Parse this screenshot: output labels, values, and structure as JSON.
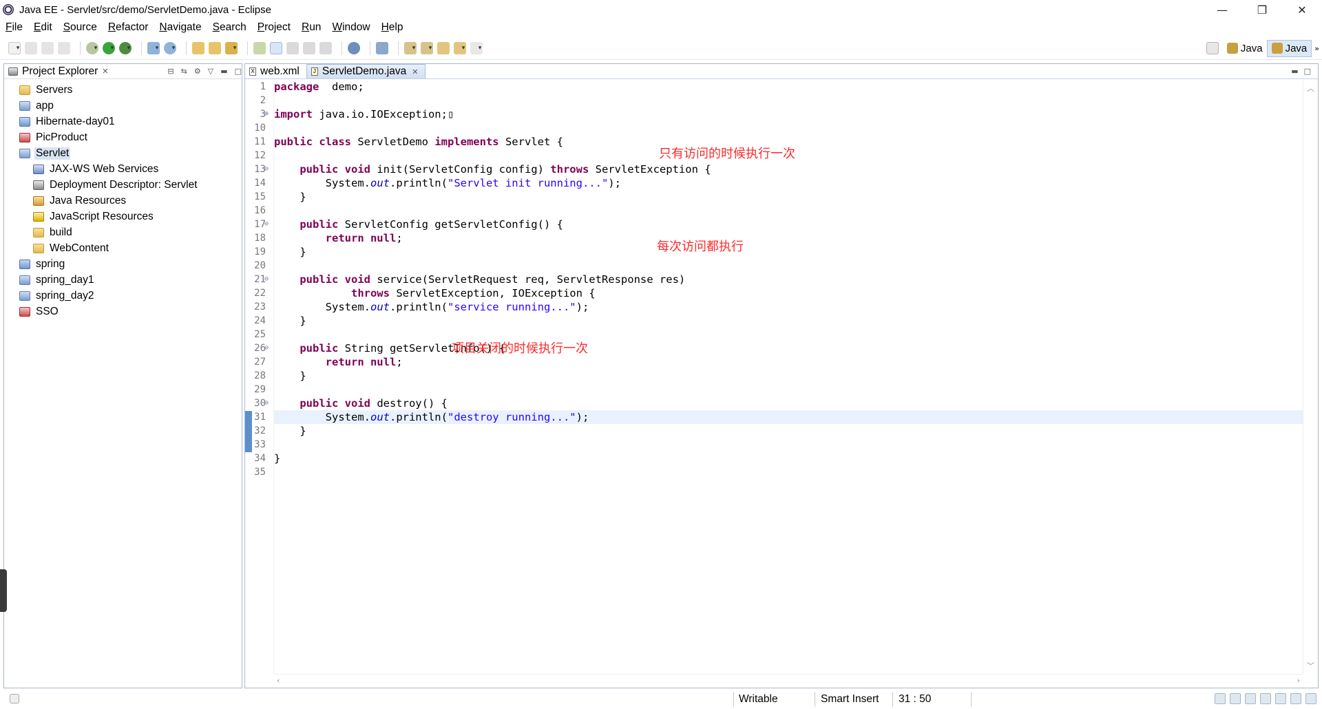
{
  "window": {
    "title": "Java EE - Servlet/src/demo/ServletDemo.java - Eclipse",
    "controls": [
      "—",
      "❐",
      "✕"
    ]
  },
  "menu": [
    "File",
    "Edit",
    "Source",
    "Refactor",
    "Navigate",
    "Search",
    "Project",
    "Run",
    "Window",
    "Help"
  ],
  "perspectives": [
    {
      "label": "Java",
      "active": false
    },
    {
      "label": "Java",
      "active": true
    }
  ],
  "explorer": {
    "title": "Project Explorer",
    "items": [
      {
        "label": "Servers",
        "level": 0,
        "icon": "folder-icon"
      },
      {
        "label": "app",
        "level": 0,
        "icon": "web-project-icon"
      },
      {
        "label": "Hibernate-day01",
        "level": 0,
        "icon": "java-project-icon"
      },
      {
        "label": "PicProduct",
        "level": 0,
        "icon": "web-project-error-icon"
      },
      {
        "label": "Servlet",
        "level": 0,
        "icon": "web-project-icon",
        "selected": true
      },
      {
        "label": "JAX-WS Web Services",
        "level": 1,
        "icon": "web-services-icon"
      },
      {
        "label": "Deployment Descriptor: Servlet",
        "level": 1,
        "icon": "deployment-descriptor-icon"
      },
      {
        "label": "Java Resources",
        "level": 1,
        "icon": "java-resources-icon"
      },
      {
        "label": "JavaScript Resources",
        "level": 1,
        "icon": "javascript-resources-icon"
      },
      {
        "label": "build",
        "level": 1,
        "icon": "folder-icon"
      },
      {
        "label": "WebContent",
        "level": 1,
        "icon": "folder-icon"
      },
      {
        "label": "spring",
        "level": 0,
        "icon": "java-project-icon"
      },
      {
        "label": "spring_day1",
        "level": 0,
        "icon": "web-project-icon"
      },
      {
        "label": "spring_day2",
        "level": 0,
        "icon": "web-project-icon"
      },
      {
        "label": "SSO",
        "level": 0,
        "icon": "web-project-error-icon"
      }
    ]
  },
  "editor": {
    "tabs": [
      {
        "label": "web.xml",
        "active": false
      },
      {
        "label": "ServletDemo.java",
        "active": true
      }
    ],
    "lines": [
      {
        "n": "1",
        "text": [
          [
            "kw",
            "package"
          ],
          [
            "",
            "  demo;"
          ]
        ]
      },
      {
        "n": "2",
        "text": []
      },
      {
        "n": "3",
        "fold": "⊕",
        "text": [
          [
            "kw",
            "import"
          ],
          [
            "",
            " java.io.IOException;"
          ],
          [
            "",
            "▯"
          ]
        ]
      },
      {
        "n": "10",
        "text": []
      },
      {
        "n": "11",
        "text": [
          [
            "kw",
            "public class"
          ],
          [
            "",
            " ServletDemo "
          ],
          [
            "kw",
            "implements"
          ],
          [
            "",
            " Servlet {"
          ]
        ]
      },
      {
        "n": "12",
        "text": []
      },
      {
        "n": "13",
        "fold": "⊖",
        "override": true,
        "text": [
          [
            "",
            "    "
          ],
          [
            "kw",
            "public void"
          ],
          [
            "",
            " init(ServletConfig config) "
          ],
          [
            "kw",
            "throws"
          ],
          [
            "",
            " ServletException {"
          ]
        ]
      },
      {
        "n": "14",
        "text": [
          [
            "",
            "        System."
          ],
          [
            "fld",
            "out"
          ],
          [
            "",
            ".println("
          ],
          [
            "str",
            "\"Servlet init running...\""
          ],
          [
            "",
            ");"
          ]
        ]
      },
      {
        "n": "15",
        "text": [
          [
            "",
            "    }"
          ]
        ]
      },
      {
        "n": "16",
        "text": []
      },
      {
        "n": "17",
        "fold": "⊖",
        "override": true,
        "text": [
          [
            "",
            "    "
          ],
          [
            "kw",
            "public"
          ],
          [
            "",
            " ServletConfig getServletConfig() {"
          ]
        ]
      },
      {
        "n": "18",
        "text": [
          [
            "",
            "        "
          ],
          [
            "kw",
            "return null"
          ],
          [
            "",
            ";"
          ]
        ]
      },
      {
        "n": "19",
        "text": [
          [
            "",
            "    }"
          ]
        ]
      },
      {
        "n": "20",
        "text": []
      },
      {
        "n": "21",
        "fold": "⊖",
        "override": true,
        "text": [
          [
            "",
            "    "
          ],
          [
            "kw",
            "public void"
          ],
          [
            "",
            " service(ServletRequest req, ServletResponse res)"
          ]
        ]
      },
      {
        "n": "22",
        "text": [
          [
            "",
            "            "
          ],
          [
            "kw",
            "throws"
          ],
          [
            "",
            " ServletException, IOException {"
          ]
        ]
      },
      {
        "n": "23",
        "text": [
          [
            "",
            "        System."
          ],
          [
            "fld",
            "out"
          ],
          [
            "",
            ".println("
          ],
          [
            "str",
            "\"service running...\""
          ],
          [
            "",
            ");"
          ]
        ]
      },
      {
        "n": "24",
        "text": [
          [
            "",
            "    }"
          ]
        ]
      },
      {
        "n": "25",
        "text": []
      },
      {
        "n": "26",
        "fold": "⊖",
        "override": true,
        "text": [
          [
            "",
            "    "
          ],
          [
            "kw",
            "public"
          ],
          [
            "",
            " String getServletInfo() {"
          ]
        ]
      },
      {
        "n": "27",
        "text": [
          [
            "",
            "        "
          ],
          [
            "kw",
            "return null"
          ],
          [
            "",
            ";"
          ]
        ]
      },
      {
        "n": "28",
        "text": [
          [
            "",
            "    }"
          ]
        ]
      },
      {
        "n": "29",
        "text": []
      },
      {
        "n": "30",
        "fold": "⊖",
        "override": true,
        "text": [
          [
            "",
            "    "
          ],
          [
            "kw",
            "public void"
          ],
          [
            "",
            " destroy() {"
          ]
        ]
      },
      {
        "n": "31",
        "current": true,
        "text": [
          [
            "",
            "        System."
          ],
          [
            "fld",
            "out"
          ],
          [
            "",
            ".println("
          ],
          [
            "str",
            "\"destroy running...\""
          ],
          [
            "",
            ");"
          ]
        ]
      },
      {
        "n": "32",
        "text": [
          [
            "",
            "    }"
          ]
        ]
      },
      {
        "n": "33",
        "text": []
      },
      {
        "n": "34",
        "text": [
          [
            "",
            "}"
          ]
        ]
      },
      {
        "n": "35",
        "text": []
      }
    ],
    "annotations": [
      {
        "text": "只有访问的时候执行一次"
      },
      {
        "text": "每次访问都执行"
      },
      {
        "text": "项目关闭的时候执行一次"
      }
    ]
  },
  "status": {
    "writable": "Writable",
    "insert_mode": "Smart Insert",
    "position": "31 : 50"
  }
}
